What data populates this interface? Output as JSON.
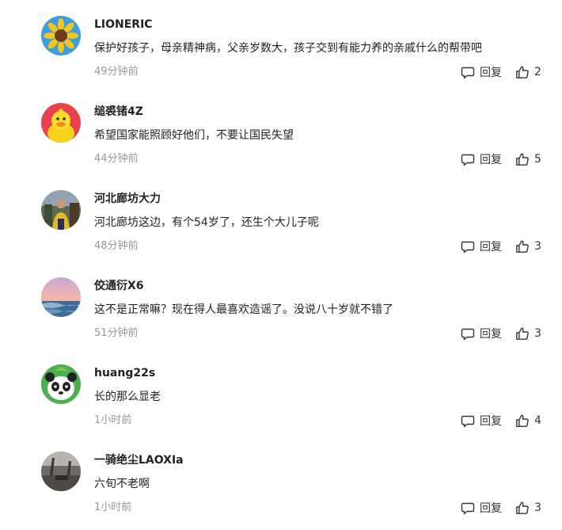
{
  "comments": [
    {
      "avatar": "sunflower-avatar",
      "username": "LIONERIC",
      "text": "保护好孩子，母亲精神病，父亲岁数大，孩子交到有能力养的亲戚什么的帮带吧",
      "time": "49分钟前",
      "reply_label": "回复",
      "likes": "2"
    },
    {
      "avatar": "yellow-duck-avatar",
      "username": "缒裘锗4Z",
      "text": "希望国家能照顾好他们，不要让国民失望",
      "time": "44分钟前",
      "reply_label": "回复",
      "likes": "5"
    },
    {
      "avatar": "person-photo-avatar",
      "username": "河北廊坊大力",
      "text": "河北廊坊这边，有个54岁了，还生个大儿子呢",
      "time": "48分钟前",
      "reply_label": "回复",
      "likes": "3"
    },
    {
      "avatar": "sunset-sea-avatar",
      "username": "佼通衍X6",
      "text": "这不是正常嘛？现在得人最喜欢造谣了。没说八十岁就不错了",
      "time": "51分钟前",
      "reply_label": "回复",
      "likes": "3"
    },
    {
      "avatar": "panda-avatar",
      "username": "huang22s",
      "text": "长的那么显老",
      "time": "1小时前",
      "reply_label": "回复",
      "likes": "4"
    },
    {
      "avatar": "dark-photo-avatar",
      "username": "一骑绝尘LAOXIa",
      "text": "六旬不老啊",
      "time": "1小时前",
      "reply_label": "回复",
      "likes": "3"
    }
  ]
}
